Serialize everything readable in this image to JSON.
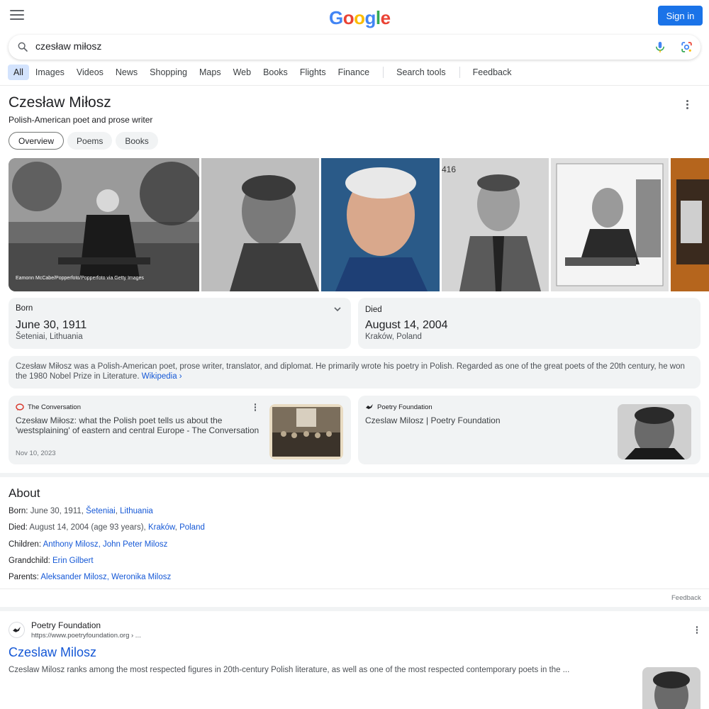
{
  "header": {
    "logo_letters": [
      "G",
      "o",
      "o",
      "g",
      "l",
      "e"
    ],
    "sign_in_label": "Sign in"
  },
  "search": {
    "query": "czesław miłosz"
  },
  "tabs": [
    {
      "label": "All",
      "active": true
    },
    {
      "label": "Images"
    },
    {
      "label": "Videos"
    },
    {
      "label": "News"
    },
    {
      "label": "Shopping"
    },
    {
      "label": "Maps"
    },
    {
      "label": "Web"
    },
    {
      "label": "Books"
    },
    {
      "label": "Flights"
    },
    {
      "label": "Finance"
    }
  ],
  "tools": {
    "search_tools_label": "Search tools",
    "feedback_label": "Feedback"
  },
  "knowledge_panel": {
    "title": "Czesław Miłosz",
    "subtitle": "Polish-American poet and prose writer",
    "chips": [
      "Overview",
      "Poems",
      "Books"
    ],
    "image_credit": "Eamonn McCabe/Popperfoto/Popperfoto via Getty Images",
    "born": {
      "label": "Born",
      "date": "June 30, 1911",
      "place": "Šeteniai, Lithuania"
    },
    "died": {
      "label": "Died",
      "date": "August 14, 2004",
      "place": "Kraków, Poland"
    },
    "description": "Czesław Miłosz was a Polish-American poet, prose writer, translator, and diplomat. He primarily wrote his poetry in Polish. Regarded as one of the great poets of the 20th century, he won the 1980 Nobel Prize in Literature.",
    "wikipedia_link": "Wikipedia ›",
    "news": [
      {
        "source": "The Conversation",
        "title": "Czesław Miłosz: what the Polish poet tells us about the 'westsplaining' of eastern and central Europe - The Conversation",
        "date": "Nov 10, 2023"
      },
      {
        "source": "Poetry Foundation",
        "title": "Czeslaw Milosz | Poetry Foundation",
        "date": ""
      }
    ]
  },
  "about": {
    "title": "About",
    "born_label": "Born:",
    "born_value": "June 30, 1911,",
    "born_link1": "Šeteniai",
    "born_sep": ",",
    "born_link2": "Lithuania",
    "died_label": "Died:",
    "died_value": "August 14, 2004 (age 93 years),",
    "died_link1": "Kraków",
    "died_sep": ",",
    "died_link2": "Poland",
    "children_label": "Children:",
    "children_links": "Anthony Milosz, John Peter Milosz",
    "grandchild_label": "Grandchild:",
    "grandchild_link": "Erin Gilbert",
    "parents_label": "Parents:",
    "parents_links": "Aleksander Milosz, Weronika Milosz",
    "feedback": "Feedback"
  },
  "result": {
    "site_name": "Poetry Foundation",
    "url": "https://www.poetryfoundation.org › ...",
    "title": "Czeslaw Milosz",
    "snippet": "Czeslaw Milosz ranks among the most respected figures in 20th-century Polish literature, as well as one of the most respected contemporary poets in the ..."
  },
  "colors": {
    "accent_blue": "#1a73e8",
    "link_blue": "#1558d6",
    "card_gray": "#f1f3f4",
    "active_tab": "#d3e3fd"
  }
}
